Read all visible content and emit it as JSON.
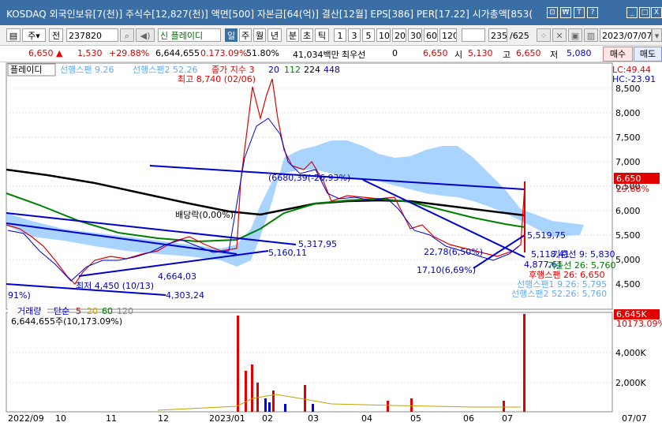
{
  "window": {
    "title": "KOSDAQ 외국인보유[7(천)] 주식수[12,827(천)] 액면[500] 자본금[64(억)] 결산[12월] EPS[386] PER[17.22] 시가총액[853(",
    "controls": [
      "⊡",
      "₩",
      "T",
      "?",
      "_",
      "□",
      "X"
    ]
  },
  "toolbar": {
    "icon_btn": "▤",
    "type": "주",
    "type_arrow": "▾",
    "market": "전",
    "code": "237820",
    "name_label": "신 플레이디",
    "periods": [
      "일",
      "주",
      "월",
      "년",
      "분",
      "초",
      "틱"
    ],
    "active_period": "일",
    "intervals": [
      "1",
      "3",
      "5",
      "10",
      "20",
      "30",
      "60",
      "120"
    ],
    "count": "235",
    "total": "/625",
    "date": "2023/07/07",
    "date_arrow": "▾"
  },
  "quote": {
    "price": "6,650",
    "change": "1,530",
    "change_pct": "+29.88%",
    "volume": "6,644,655",
    "turnover": "0.173.09%",
    "ratio": "51.80%",
    "amount": "41,034백만",
    "lowest_label": "최우선",
    "lowest_value": "0",
    "cur2": "6,650",
    "open_label": "시",
    "open_value": "5,130",
    "high_label": "고",
    "high_value": "6,650",
    "low_label": "저",
    "low_value": "5,080",
    "buy": "매수",
    "sell": "매도"
  },
  "price_panel": {
    "stock_name": "플레이디",
    "legend_span1": "선행스팬 9.26",
    "legend_span2": "선행스팬2 52.26",
    "legend_ma": "종가 지수 3",
    "legend_ma_vals": [
      "20",
      "112",
      "224",
      "448"
    ],
    "lc": "LC:49.44",
    "hc": "HC:-23.91",
    "high_note": "최고 8,740 (02/06)",
    "low_note": "최저 4,450 (10/13)",
    "pct_note": "91%)",
    "level_labels": [
      "5,317,95",
      "5,160,11",
      "4,664,03",
      "4,303,24",
      "5,519,75",
      "5,118,41",
      "4,877,61"
    ],
    "mid_label": "배당락(0,00%)",
    "mid_label2": "(6680,39(-26,93%)",
    "pct_labels": [
      "22,78(6,50%)",
      "17,10(6,69%)"
    ],
    "cur_price": "6,650",
    "cur_pct": "29.88%",
    "bottom_legend": [
      "기준선 9: 5,830",
      "기준선 26: 5,760",
      "후행스팬 26: 6,650",
      "선행스팬1 9.26: 5,795",
      "선행스팬2 52.26: 5,760"
    ],
    "y_ticks": [
      "8,500",
      "8,000",
      "7,500",
      "7,000",
      "6,500",
      "6,000",
      "5,500",
      "5,000",
      "4,500"
    ]
  },
  "volume_panel": {
    "label": "거래량",
    "legend": [
      "단순",
      "5",
      "20",
      "60",
      "120"
    ],
    "value": "6,644,655주(10,173.09%)",
    "cur": "6,645K",
    "cur_pct": "10173.09%",
    "y_ticks": [
      "4,000K",
      "2,000K"
    ]
  },
  "x_axis": [
    "2022/09",
    "10",
    "11",
    "12",
    "2023/01",
    "02",
    "03",
    "04",
    "05",
    "06",
    "07",
    "07/07"
  ],
  "colors": {
    "title_bg": "#3a6ea5",
    "up": "#e00000",
    "down": "#0000e0",
    "cloud": "#99ccff",
    "ma_black": "#000000",
    "ma_green": "#008000",
    "trend": "#0000cc"
  }
}
